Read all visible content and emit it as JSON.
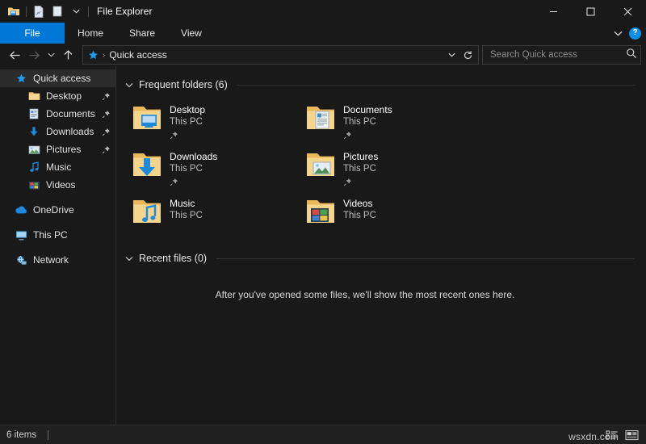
{
  "window": {
    "title": "File Explorer",
    "controls": {
      "minimize": "—",
      "maximize": "☐",
      "close": "✕"
    },
    "quick_access_toolbar": [
      {
        "name": "folder-icon",
        "label": "Quick Access Toolbar Folder"
      },
      {
        "name": "properties-icon",
        "label": "Properties"
      },
      {
        "name": "new-folder-icon",
        "label": "New folder"
      },
      {
        "name": "chevron-down-icon",
        "label": "Customize Quick Access Toolbar"
      }
    ]
  },
  "ribbon": {
    "tabs": [
      {
        "label": "File",
        "active": true
      },
      {
        "label": "Home",
        "active": false
      },
      {
        "label": "Share",
        "active": false
      },
      {
        "label": "View",
        "active": false
      }
    ],
    "expand_label": "∨",
    "help_label": "?"
  },
  "navbar": {
    "back_label": "←",
    "forward_label": "→",
    "history_label": "∨",
    "up_label": "↑",
    "breadcrumb": {
      "icon": "star-icon",
      "separator": "›",
      "text": "Quick access"
    },
    "address_dropdown_label": "∨",
    "refresh_label": "↻"
  },
  "search": {
    "placeholder": "Search Quick access",
    "value": "",
    "icon": "search-icon"
  },
  "sidebar": {
    "items": [
      {
        "label": "Quick access",
        "icon": "star-icon",
        "level": "root",
        "selected": true,
        "pinned": false
      },
      {
        "label": "Desktop",
        "icon": "desktop-folder-icon",
        "level": "child",
        "selected": false,
        "pinned": true
      },
      {
        "label": "Documents",
        "icon": "documents-icon",
        "level": "child",
        "selected": false,
        "pinned": true
      },
      {
        "label": "Downloads",
        "icon": "downloads-icon",
        "level": "child",
        "selected": false,
        "pinned": true
      },
      {
        "label": "Pictures",
        "icon": "pictures-icon",
        "level": "child",
        "selected": false,
        "pinned": true
      },
      {
        "label": "Music",
        "icon": "music-icon",
        "level": "child",
        "selected": false,
        "pinned": false
      },
      {
        "label": "Videos",
        "icon": "videos-icon",
        "level": "child",
        "selected": false,
        "pinned": false
      },
      {
        "label": "OneDrive",
        "icon": "cloud-icon",
        "level": "root",
        "selected": false,
        "pinned": false,
        "group": true
      },
      {
        "label": "This PC",
        "icon": "monitor-icon",
        "level": "root",
        "selected": false,
        "pinned": false,
        "group": true
      },
      {
        "label": "Network",
        "icon": "network-icon",
        "level": "root",
        "selected": false,
        "pinned": false,
        "group": true
      }
    ]
  },
  "main": {
    "frequent_folders": {
      "title": "Frequent folders (6)",
      "collapse_icon": "chevron-down-icon",
      "items": [
        {
          "name": "Desktop",
          "location": "This PC",
          "icon": "desktop-folder-icon",
          "pinned": true
        },
        {
          "name": "Documents",
          "location": "This PC",
          "icon": "documents-folder-icon",
          "pinned": true
        },
        {
          "name": "Downloads",
          "location": "This PC",
          "icon": "downloads-folder-icon",
          "pinned": true
        },
        {
          "name": "Pictures",
          "location": "This PC",
          "icon": "pictures-folder-icon",
          "pinned": true
        },
        {
          "name": "Music",
          "location": "This PC",
          "icon": "music-folder-icon",
          "pinned": false
        },
        {
          "name": "Videos",
          "location": "This PC",
          "icon": "videos-folder-icon",
          "pinned": false
        }
      ]
    },
    "recent_files": {
      "title": "Recent files (0)",
      "collapse_icon": "chevron-down-icon",
      "empty_message": "After you've opened some files, we'll show the most recent ones here."
    }
  },
  "statusbar": {
    "item_count": "6 items",
    "view_details_label": "Details view",
    "view_icons_label": "Large icons view",
    "watermark": "wsxdn.com"
  },
  "colors": {
    "accent": "#0078d7",
    "folder": "#f5c96b",
    "window_bg": "#191919",
    "selected_row": "#2b2b2b",
    "help_blue": "#0b8fe8"
  }
}
